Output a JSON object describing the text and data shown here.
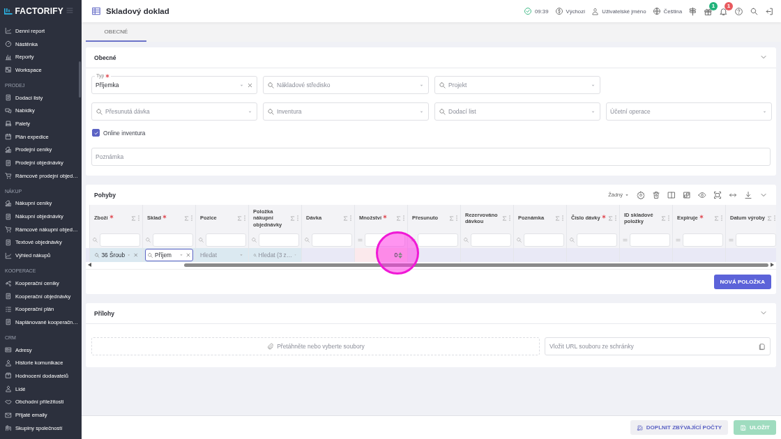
{
  "app": {
    "logo": "FACTORIFY"
  },
  "sidebar": {
    "sections": [
      {
        "items": [
          "Denní report",
          "Nástěnka",
          "Reporty",
          "Workspace"
        ]
      },
      {
        "title": "PRODEJ",
        "items": [
          "Dodací listy",
          "Nabídky",
          "Palety",
          "Plán expedice",
          "Prodejní ceníky",
          "Prodejní objednávky",
          "Rámcové prodejní objed…"
        ]
      },
      {
        "title": "NÁKUP",
        "items": [
          "Nákupní ceníky",
          "Nákupní objednávky",
          "Rámcové nákupní objed…",
          "Textové objednávky",
          "Výhled nákupů"
        ]
      },
      {
        "title": "KOOPERACE",
        "items": [
          "Kooperační ceníky",
          "Kooperační objednávky",
          "Kooperační plán",
          "Naplánované kooperačn…"
        ]
      },
      {
        "title": "CRM",
        "items": [
          "Adresy",
          "Historie komunikace",
          "Hodnocení dodavatelů",
          "Lidé",
          "Obchodní příležitosti",
          "Přijaté emaily",
          "Skupiny společností"
        ]
      }
    ]
  },
  "header": {
    "title": "Skladový doklad",
    "time": "09:39",
    "currency": "Výchozí",
    "user": "Uživatelské jméno",
    "language": "Čeština",
    "gift_badge": "1",
    "notification_badge": "1"
  },
  "tabs": [
    {
      "label": "OBECNÉ",
      "selected": true
    }
  ],
  "general": {
    "title": "Obecné",
    "fields": [
      [
        {
          "label": "Typ",
          "required": true,
          "value": "Příjemka",
          "clearable": true,
          "search": false
        },
        {
          "placeholder": "Nákladové středisko",
          "search": true
        },
        {
          "placeholder": "Projekt",
          "search": true
        }
      ],
      [
        {
          "placeholder": "Přesunutá dávka",
          "search": true
        },
        {
          "placeholder": "Inventura",
          "search": true
        },
        {
          "placeholder": "Dodací list",
          "search": true
        },
        {
          "placeholder": "Účetní operace",
          "search": false
        }
      ]
    ],
    "online_inventory": {
      "label": "Online inventura",
      "checked": true
    },
    "note": {
      "placeholder": "Poznámka"
    }
  },
  "movements": {
    "title": "Pohyby",
    "view": "Žádný",
    "columns": [
      {
        "label": "Zboží",
        "required": true,
        "kind": "search"
      },
      {
        "label": "Sklad",
        "required": true,
        "kind": "search"
      },
      {
        "label": "Pozice",
        "required": false,
        "kind": "search"
      },
      {
        "label": "Položka nákupní objednávky",
        "required": false,
        "kind": "search"
      },
      {
        "label": "Dávka",
        "required": false,
        "kind": "search"
      },
      {
        "label": "Množství",
        "required": true,
        "kind": "equals"
      },
      {
        "label": "Přesunuto",
        "required": false,
        "kind": "equals"
      },
      {
        "label": "Rezervováno dávkou",
        "required": false,
        "kind": "search"
      },
      {
        "label": "Poznámka",
        "required": false,
        "kind": "search"
      },
      {
        "label": "Číslo dávky",
        "required": true,
        "kind": "search"
      },
      {
        "label": "ID skladové položky",
        "required": false,
        "kind": "equals"
      },
      {
        "label": "Expiruje",
        "required": true,
        "kind": "equals"
      },
      {
        "label": "Datum výroby",
        "required": false,
        "kind": "equals"
      }
    ],
    "row": {
      "selected": true,
      "cells": [
        {
          "kind": "select",
          "value": "36 Šroub",
          "search": true,
          "clearable": true,
          "focused": false,
          "editable": true
        },
        {
          "kind": "select",
          "value": "Příjem",
          "search": true,
          "clearable": true,
          "focused": true,
          "editable": true
        },
        {
          "kind": "select",
          "placeholder": "Hledat",
          "search": false,
          "clearable": false,
          "focused": false,
          "editable": true
        },
        {
          "kind": "select",
          "placeholder": "Hledat (3 z…",
          "search": true,
          "clearable": false,
          "focused": false,
          "editable": true
        },
        {
          "kind": "empty"
        },
        {
          "kind": "number",
          "value": "0",
          "invalid": true
        },
        {
          "kind": "empty"
        },
        {
          "kind": "empty"
        },
        {
          "kind": "empty"
        },
        {
          "kind": "empty"
        },
        {
          "kind": "empty"
        },
        {
          "kind": "empty"
        },
        {
          "kind": "empty"
        }
      ]
    },
    "add_button": "NOVÁ POLOŽKA"
  },
  "attachments": {
    "title": "Přílohy",
    "dropzone": "Přetáhněte nebo vyberte soubory",
    "url_field": {
      "placeholder": "Vložit URL souboru ze schránky"
    }
  },
  "footer": {
    "buttons": [
      {
        "label": "DOPLNIT ZBÝVAJÍCÍ POČTY",
        "kind": "fill",
        "disabled": false
      },
      {
        "label": "ULOŽIT",
        "kind": "save",
        "disabled": true
      }
    ]
  }
}
